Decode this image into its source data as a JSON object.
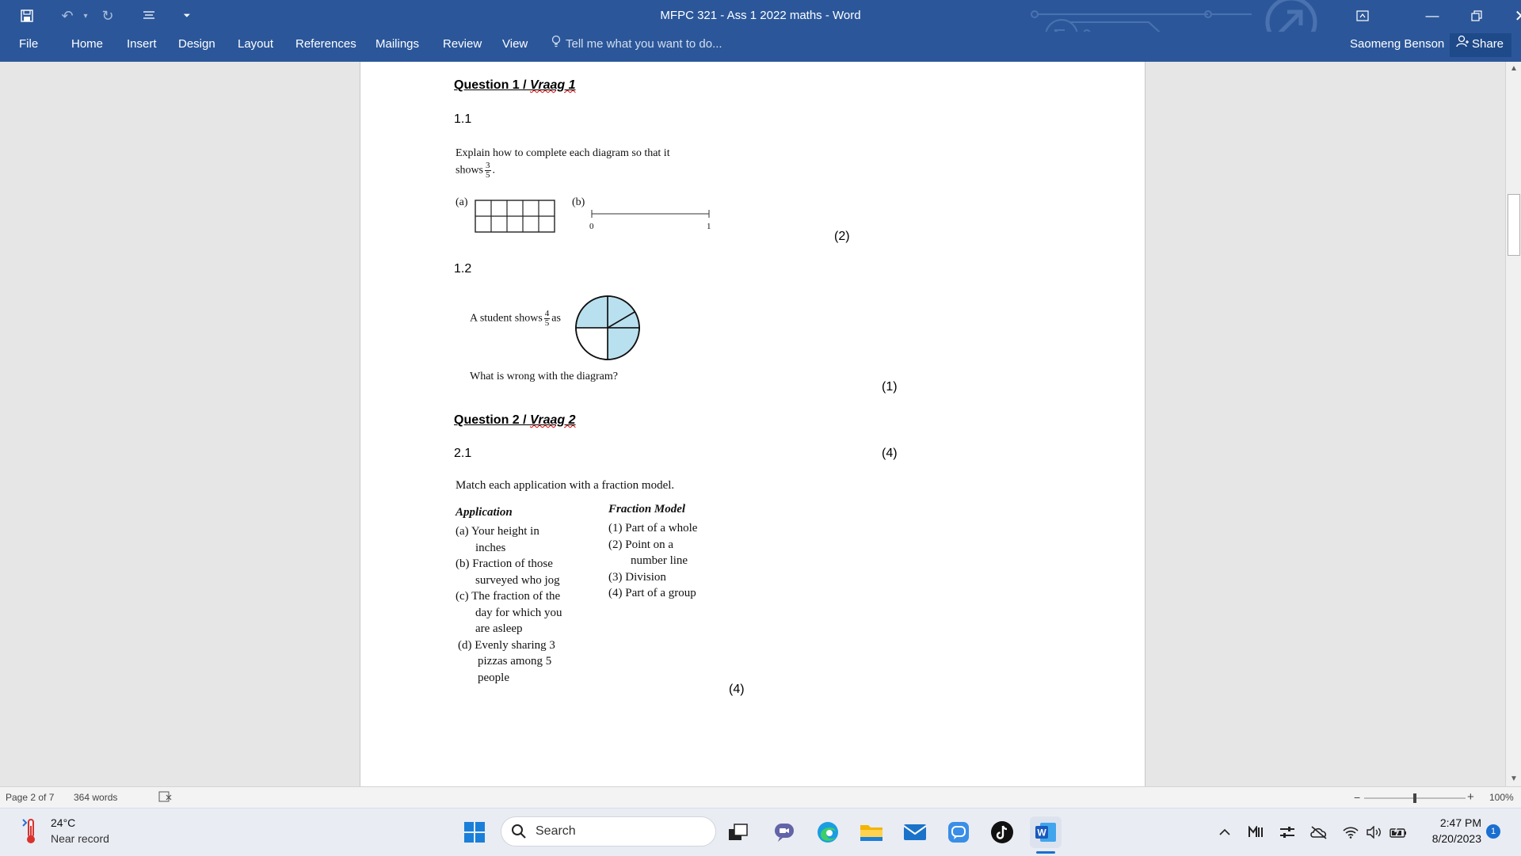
{
  "window": {
    "title": "MFPC 321 - Ass 1 2022 maths - Word"
  },
  "ribbon": {
    "file": "File",
    "tabs": [
      "Home",
      "Insert",
      "Design",
      "Layout",
      "References",
      "Mailings",
      "Review",
      "View"
    ],
    "tell_me": "Tell me what you want to do...",
    "user": "Saomeng Benson",
    "share": "Share"
  },
  "document": {
    "q1_heading": "Question 1 / ",
    "q1_heading_italic": "Vraag 1",
    "q1_1_num": "1.1",
    "q1_1_text_a": "Explain how to complete each diagram so that it",
    "q1_1_text_b": "shows",
    "q1_1_frac_num": "3",
    "q1_1_frac_den": "5",
    "q1_1_label_a": "(a)",
    "q1_1_label_b": "(b)",
    "numberline_start": "0",
    "numberline_end": "1",
    "q1_1_marks": "(2)",
    "q1_2_num": "1.2",
    "q1_2_text_pre": "A student shows",
    "q1_2_frac_num": "4",
    "q1_2_frac_den": "5",
    "q1_2_text_post": "as",
    "q1_2_question": "What is wrong with the diagram?",
    "q1_2_marks": "(1)",
    "q2_heading": "Question 2 / ",
    "q2_heading_italic": "Vraag 2",
    "q2_1_num": "2.1",
    "q2_1_marks": "(4)",
    "q2_1_intro": "Match each application with a fraction model.",
    "app_header": "Application",
    "model_header": "Fraction Model",
    "app_lines": [
      "(a) Your height in",
      "inches",
      "(b) Fraction of those",
      "surveyed who jog",
      "(c) The fraction of the",
      "day for which you",
      "are asleep",
      "(d) Evenly sharing 3",
      "pizzas among 5",
      "people"
    ],
    "model_lines": [
      "(1)  Part of a whole",
      "(2)  Point on a",
      "number line",
      "(3)  Division",
      "(4)  Part of a group"
    ],
    "q2_1_marks_bottom": "(4)"
  },
  "status": {
    "page": "Page 2 of 7",
    "words": "364 words",
    "zoom": "100%",
    "zoom_minus": "−",
    "zoom_plus": "+"
  },
  "taskbar": {
    "weather_temp": "24°C",
    "weather_desc": "Near record",
    "search": "Search",
    "time": "2:47 PM",
    "date": "8/20/2023",
    "notif_count": "1"
  },
  "colors": {
    "word_blue": "#2b579a",
    "pie_fill": "#b9e0ef"
  }
}
